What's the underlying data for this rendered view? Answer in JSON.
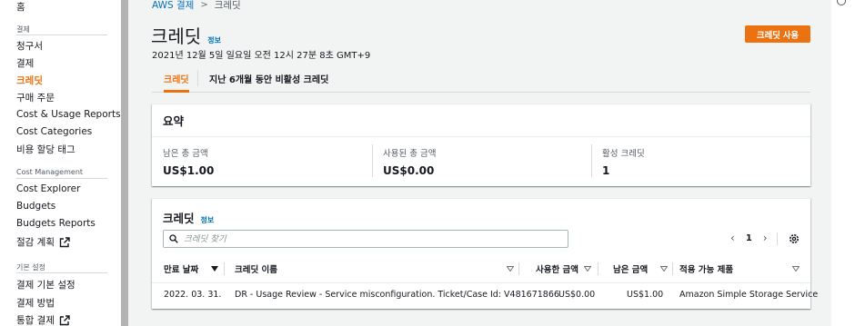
{
  "sidebar": {
    "home": "홈",
    "billing_section": "결제",
    "bills": "청구서",
    "payments": "결제",
    "credits": "크레딧",
    "purchase_orders": "구매 주문",
    "cost_usage_reports": "Cost & Usage Reports",
    "cost_categories": "Cost Categories",
    "cost_allocation_tags": "비용 할당 태그",
    "cost_management_section": "Cost Management",
    "cost_explorer": "Cost Explorer",
    "budgets": "Budgets",
    "budgets_reports": "Budgets Reports",
    "savings_plans": "절감 계획",
    "preferences_section": "기본 설정",
    "billing_preferences": "결제 기본 설정",
    "payment_methods": "결제 방법",
    "consolidated_billing": "통합 결제"
  },
  "breadcrumb": {
    "parent": "AWS 결제",
    "current": "크레딧"
  },
  "header": {
    "title": "크레딧",
    "info": "정보",
    "timestamp": "2021년 12월 5일 일요일 오전 12시 27분 8초 GMT+9",
    "redeem_button": "크레딧 사용"
  },
  "tabs": [
    {
      "label": "크레딧",
      "active": true
    },
    {
      "label": "지난 6개월 동안 비활성 크레딧",
      "active": false
    }
  ],
  "summary": {
    "title": "요약",
    "items": [
      {
        "label": "남은 총 금액",
        "value": "US$1.00"
      },
      {
        "label": "사용된 총 금액",
        "value": "US$0.00"
      },
      {
        "label": "활성 크레딧",
        "value": "1"
      }
    ]
  },
  "credits_table": {
    "title": "크레딧",
    "info": "정보",
    "search_placeholder": "크레딧 찾기",
    "current_page": "1",
    "columns": [
      "만료 날짜",
      "크레딧 이름",
      "사용한 금액",
      "남은 금액",
      "적용 가능 제품"
    ],
    "rows": [
      {
        "expiration": "2022. 03. 31.",
        "name": "DR - Usage Review - Service misconfiguration. Ticket/Case Id: V481671866",
        "used": "US$0.00",
        "remaining": "US$1.00",
        "products": "Amazon Simple Storage Service"
      }
    ]
  },
  "colors": {
    "accent": "#ec7211",
    "link": "#0073bb"
  }
}
